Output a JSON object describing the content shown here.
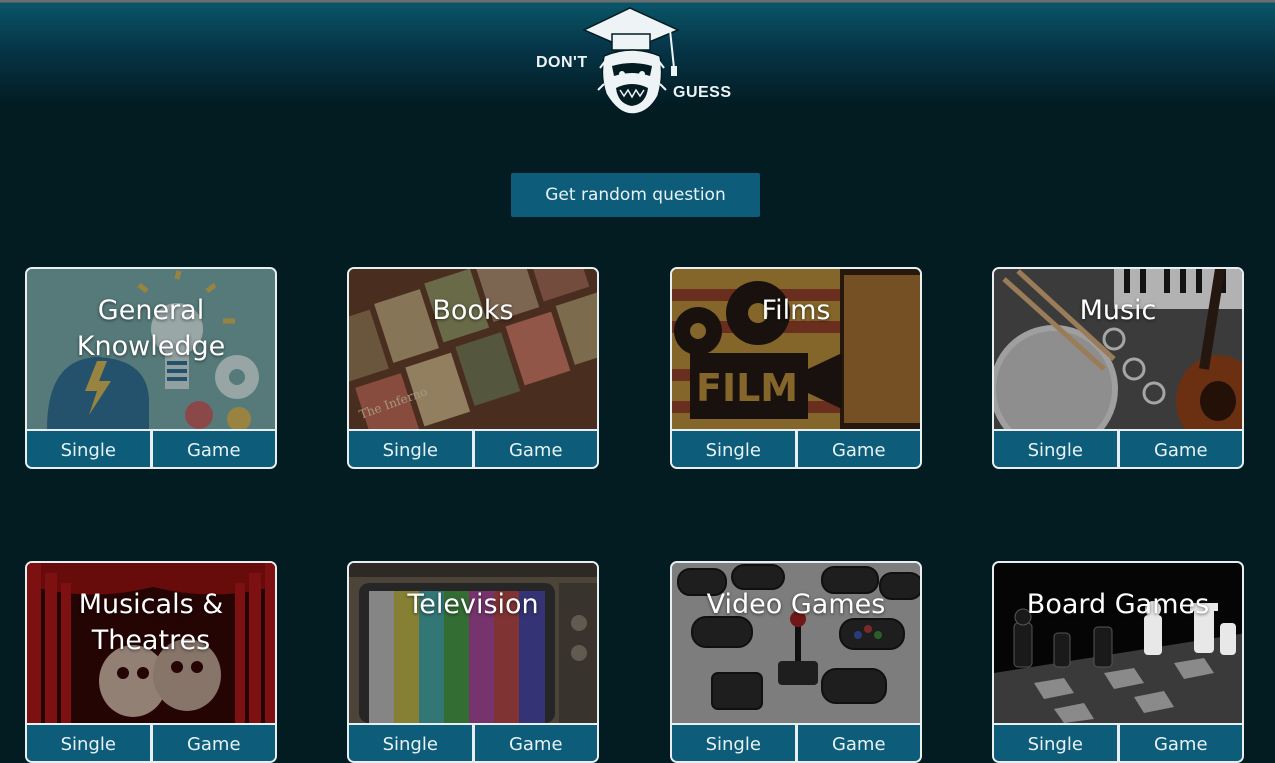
{
  "header": {
    "logo_top": "DON'T",
    "logo_bottom": "GUESS"
  },
  "random_button": "Get random question",
  "categories": [
    {
      "title": "General Knowledge",
      "single": "Single",
      "game": "Game"
    },
    {
      "title": "Books",
      "single": "Single",
      "game": "Game"
    },
    {
      "title": "Films",
      "single": "Single",
      "game": "Game"
    },
    {
      "title": "Music",
      "single": "Single",
      "game": "Game"
    },
    {
      "title": "Musicals & Theatres",
      "single": "Single",
      "game": "Game"
    },
    {
      "title": "Television",
      "single": "Single",
      "game": "Game"
    },
    {
      "title": "Video Games",
      "single": "Single",
      "game": "Game"
    },
    {
      "title": "Board Games",
      "single": "Single",
      "game": "Game"
    }
  ],
  "image_labels": {
    "film_sign": "FILM",
    "book_cover": "The Inferno"
  },
  "colors": {
    "background": "#021c22",
    "accent": "#0d5d7a",
    "card_border": "#e9eef0"
  }
}
